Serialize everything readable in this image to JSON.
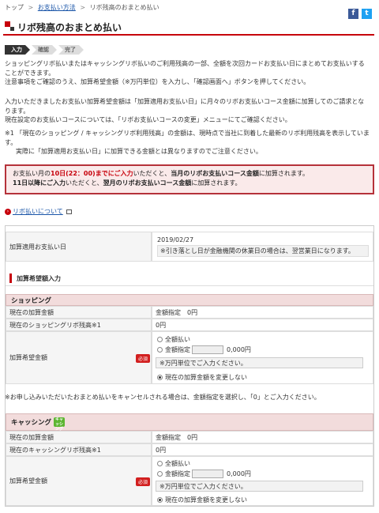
{
  "breadcrumb": {
    "top": "トップ",
    "method": "お支払い方法",
    "current": "リボ残高のおまとめ払い",
    "sep": ">"
  },
  "social": {
    "facebook": "f",
    "twitter": "t",
    "facebook_color": "#3b5998",
    "twitter_color": "#1da1f2"
  },
  "page_title": "リボ残高のおまとめ払い",
  "steps": [
    "入力",
    "確認",
    "完了"
  ],
  "intro": {
    "l1": "ショッピングリボ払いまたはキャッシングリボ払いのご利用残高の一部、全額を次回カードお支払い日にまとめてお支払いする",
    "l2": "ことができます。",
    "l3": "注意事項をご確認のうえ、加算希望金額（※万円単位）を入力し、「確認画面へ」ボタンを押してください。"
  },
  "info": {
    "l1": "入力いただきましたお支払い加算希望金額は「加算適用お支払い日」に月々のリボお支払いコース金額に加算してのご請求とな",
    "l2": "ります。",
    "l3": "現在設定のお支払いコースについては、「リボお支払いコースの変更」メニューにてご確認ください。"
  },
  "note1": {
    "l1": "※1 「現在のショッピング / キャッシングリボ利用残高」の金額は、現時点で当社に到着した最新のリボ利用残高を表示しています。",
    "l2": "実際に「加算適用お支払い日」に加算できる金額とは異なりますのでご注意ください。"
  },
  "alert": {
    "a1": "お支払い月の",
    "a2": "10日(22：00)までにご入力",
    "a3": "いただくと、",
    "a4": "当月のリボお支払いコース金額",
    "a5": "に加算されます。",
    "b1": "11日以降にご入力",
    "b2": "いただくと、",
    "b3": "翌月のリボお支払いコース金額",
    "b4": "に加算されます。"
  },
  "revo_link": "リボ払いについて",
  "date_row": {
    "label": "加算適用お支払い日",
    "value": "2019/02/27",
    "note": "※引き落とし日が金融機関の休業日の場合は、翌営業日になります。"
  },
  "input_section": "加算希望額入力",
  "shopping": {
    "header": "ショッピング",
    "current_add_label": "現在の加算金額",
    "current_add_value": "金額指定　0円",
    "balance_label": "現在のショッピングリボ残高※1",
    "balance_value": "0円",
    "amount_label": "加算希望金額",
    "required": "必須",
    "opt_full": "全額払い",
    "opt_specify": "金額指定",
    "specify_suffix": "0,000円",
    "hint": "※万円単位でご入力ください。",
    "opt_keep": "現在の加算金額を変更しない"
  },
  "cancel_note": "※お申し込みいただいたおまとめ払いをキャンセルされる場合は、金額指定を選択し、「0」とご入力ください。",
  "cashing": {
    "header": "キャッシング",
    "badge": "キャッシング",
    "current_add_label": "現在の加算金額",
    "current_add_value": "金額指定　0円",
    "balance_label": "現在のキャッシングリボ残高※1",
    "balance_value": "0円",
    "amount_label": "加算希望金額",
    "required": "必須",
    "opt_full": "全額払い",
    "opt_specify": "金額指定",
    "specify_suffix": "0,000円",
    "hint": "※万円単位でご入力ください。",
    "opt_keep": "現在の加算金額を変更しない"
  }
}
